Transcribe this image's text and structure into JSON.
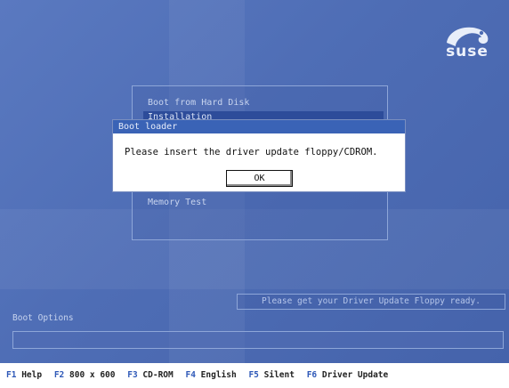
{
  "logo": {
    "text": "suse"
  },
  "menu": {
    "items": [
      {
        "label": "Boot from Hard Disk",
        "selected": false
      },
      {
        "label": "Installation",
        "selected": true
      },
      {
        "label": "Memory Test",
        "selected": false
      }
    ]
  },
  "dialog": {
    "title": "Boot loader",
    "message": "Please insert the driver update floppy/CDROM.",
    "ok_label": "OK"
  },
  "hint": "Please get your Driver Update Floppy ready.",
  "boot_options": {
    "label": "Boot Options",
    "value": ""
  },
  "function_keys": [
    {
      "key": "F1",
      "label": "Help"
    },
    {
      "key": "F2",
      "label": "800 x 600"
    },
    {
      "key": "F3",
      "label": "CD-ROM"
    },
    {
      "key": "F4",
      "label": "English"
    },
    {
      "key": "F5",
      "label": "Silent"
    },
    {
      "key": "F6",
      "label": "Driver Update"
    }
  ],
  "colors": {
    "accent": "#3a63b6",
    "background": "#4d6cb3",
    "selection": "#2d4c9a"
  }
}
